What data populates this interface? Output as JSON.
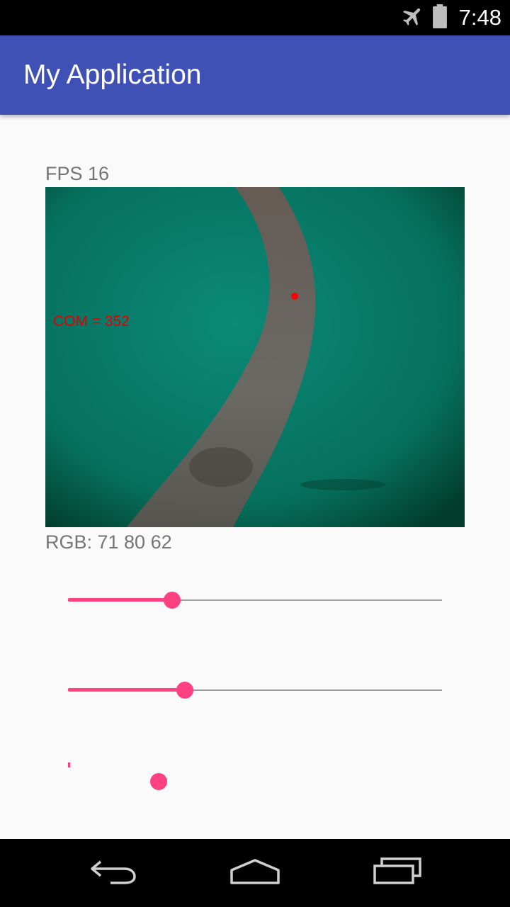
{
  "status_bar": {
    "time": "7:48",
    "icons": [
      "airplane-mode-icon",
      "battery-icon"
    ]
  },
  "app_bar": {
    "title": "My Application"
  },
  "main": {
    "fps_label": "FPS 16",
    "camera_overlay_text": "COM = 352",
    "rgb_label": "RGB: 71 80 62",
    "sliders": [
      {
        "name": "slider-1",
        "fraction": 0.28
      },
      {
        "name": "slider-2",
        "fraction": 0.31
      },
      {
        "name": "slider-3",
        "fraction": 0.24
      }
    ]
  },
  "nav_bar": {
    "buttons": [
      "back-icon",
      "home-icon",
      "recents-icon"
    ]
  },
  "colors": {
    "primary": "#3f51b5",
    "accent": "#ff4081",
    "overlay_text": "#e00000"
  }
}
